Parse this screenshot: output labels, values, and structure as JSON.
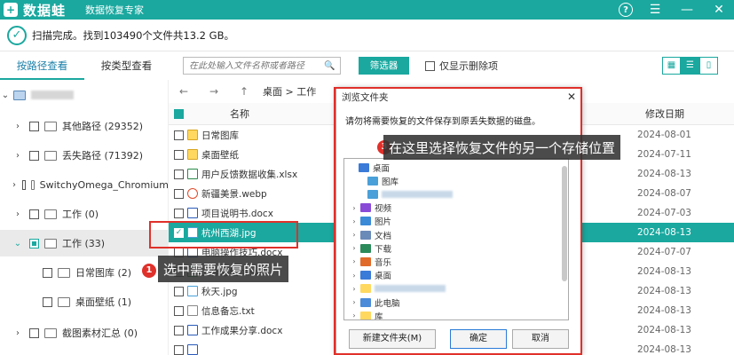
{
  "app": {
    "name": "数据蛙",
    "subtitle": "数据恢复专家",
    "logo_glyph": "+"
  },
  "window_controls": {
    "help": "?",
    "menu": "☰",
    "minimize": "—",
    "close": "✕"
  },
  "status": {
    "icon": "✓",
    "text": "扫描完成。找到103490个文件共13.2 GB。"
  },
  "tabs": [
    {
      "label": "按路径查看",
      "active": true
    },
    {
      "label": "按类型查看",
      "active": false
    }
  ],
  "toolbar": {
    "search_placeholder": "在此处输入文件名称或者路径",
    "filter_label": "筛选器",
    "only_deleted_label": "仅显示删除项",
    "view_icons": [
      "▦",
      "☰",
      "▯"
    ]
  },
  "tree": [
    {
      "label": "",
      "blurred": true,
      "chevron": "⌄"
    },
    {
      "label": "其他路径 (29352)",
      "chevron": "›"
    },
    {
      "label": "丢失路径 (71392)",
      "chevron": "›"
    },
    {
      "label": "SwitchyOmega_Chromium",
      "chevron": "›"
    },
    {
      "label": "工作 (0)",
      "chevron": "›"
    },
    {
      "label": "工作 (33)",
      "chevron": "⌄",
      "selected": true
    },
    {
      "label": "日常图库 (2)",
      "chevron": ""
    },
    {
      "label": "桌面壁纸 (1)",
      "chevron": ""
    },
    {
      "label": "截图素材汇总 (0)",
      "chevron": "›"
    }
  ],
  "navbar": {
    "back": "←",
    "forward": "→",
    "up": "↑",
    "breadcrumb": "桌面 > 工作"
  },
  "columns": {
    "name": "名称",
    "date": "修改日期"
  },
  "files": [
    {
      "name": "日常图库",
      "date": "2024-08-01",
      "type": "folder"
    },
    {
      "name": "桌面壁纸",
      "date": "2024-07-11",
      "type": "folder"
    },
    {
      "name": "用户反馈数据收集.xlsx",
      "date": "2024-08-13",
      "type": "xls"
    },
    {
      "name": "新疆美景.webp",
      "date": "2024-08-07",
      "type": "web"
    },
    {
      "name": "项目说明书.docx",
      "date": "2024-07-03",
      "type": "doc"
    },
    {
      "name": "杭州西湖.jpg",
      "date": "2024-08-13",
      "type": "img",
      "selected": true
    },
    {
      "name": "电脑操作技巧.docx",
      "date": "2024-07-07",
      "type": "doc"
    },
    {
      "name": "工作总结.xlsx",
      "date": "2024-08-13",
      "type": "xls"
    },
    {
      "name": "秋天.jpg",
      "date": "2024-08-13",
      "type": "img"
    },
    {
      "name": "信息备忘.txt",
      "date": "2024-08-13",
      "type": "txt"
    },
    {
      "name": "工作成果分享.docx",
      "date": "2024-08-13",
      "type": "doc"
    },
    {
      "name": "",
      "date": "2024-08-13",
      "type": "doc"
    }
  ],
  "annotations": {
    "step1_badge": "1",
    "step1_text": "选中需要恢复的照片",
    "step3_badge": "3",
    "step3_text": "在这里选择恢复文件的另一个存储位置"
  },
  "dialog": {
    "title": "浏览文件夹",
    "close": "✕",
    "message": "请勿将需要恢复的文件保存到原丢失数据的磁盘。",
    "items": [
      {
        "label": "桌面",
        "chev": "",
        "color": "#3a7ad8"
      },
      {
        "label": "图库",
        "chev": "",
        "color": "#4aa0d8"
      },
      {
        "label": "",
        "chev": "",
        "color": "#4aa0d8",
        "blurred": true
      },
      {
        "label": "视频",
        "chev": "›",
        "color": "#8a4ad8"
      },
      {
        "label": "图片",
        "chev": "›",
        "color": "#3a8ad8"
      },
      {
        "label": "文档",
        "chev": "›",
        "color": "#6a8ab8"
      },
      {
        "label": "下载",
        "chev": "›",
        "color": "#2a8a5a"
      },
      {
        "label": "音乐",
        "chev": "›",
        "color": "#e06a2a"
      },
      {
        "label": "桌面",
        "chev": "›",
        "color": "#3a7ad8"
      },
      {
        "label": "",
        "chev": "›",
        "color": "#ffd860",
        "blurred": true
      },
      {
        "label": "此电脑",
        "chev": "›",
        "color": "#4a8ad8"
      },
      {
        "label": "库",
        "chev": "›",
        "color": "#ffd860"
      }
    ],
    "new_folder": "新建文件夹(M)",
    "ok": "确定",
    "cancel": "取消"
  }
}
